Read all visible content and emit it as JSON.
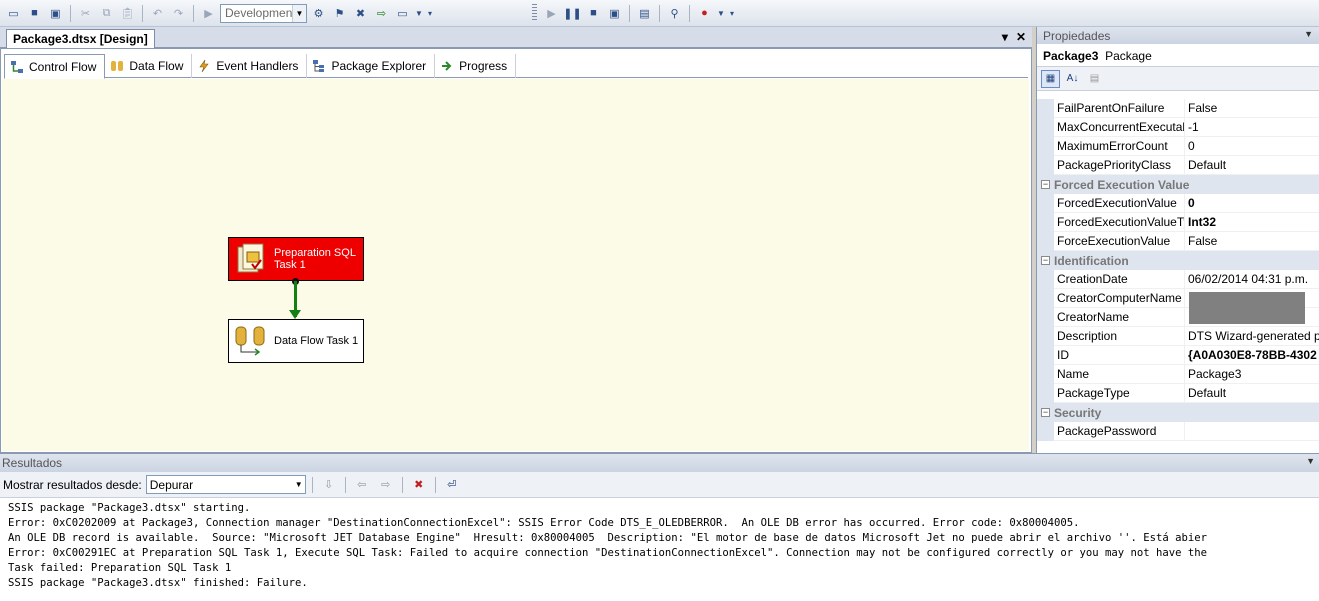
{
  "toolbar": {
    "configuration": "Development",
    "icons": [
      "new-item-icon",
      "save-icon",
      "save-all-icon",
      "cut-icon",
      "copy-icon",
      "paste-icon",
      "undo-icon",
      "redo-icon",
      "navigate-icon",
      "solution-config-combo",
      "connection-icon",
      "package-config-icon",
      "tools-icon",
      "import-icon",
      "window-icon",
      "start-icon",
      "pause-icon",
      "stop-icon",
      "restart-icon",
      "comment-icon",
      "breakpoint-icon",
      "options-icon"
    ]
  },
  "document": {
    "tab_label": "Package3.dtsx [Design]",
    "controls": [
      "▾",
      "✕"
    ]
  },
  "designer_tabs": [
    {
      "label": "Control Flow",
      "active": true
    },
    {
      "label": "Data Flow",
      "active": false
    },
    {
      "label": "Event Handlers",
      "active": false
    },
    {
      "label": "Package Explorer",
      "active": false
    },
    {
      "label": "Progress",
      "active": false
    }
  ],
  "tasks": {
    "prep": {
      "label": "Preparation SQL Task 1",
      "status": "failed",
      "color": "#ee0000"
    },
    "dataflow": {
      "label": "Data Flow Task 1"
    }
  },
  "colors": {
    "connector": "#138013",
    "canvas": "#fcfbe8"
  },
  "properties": {
    "title": "Propiedades",
    "object_name": "Package3",
    "object_type": "Package",
    "rows": [
      {
        "kind": "prop",
        "name": "FailParentOnFailure",
        "value": "False"
      },
      {
        "kind": "prop",
        "name": "MaxConcurrentExecutab",
        "value": "-1"
      },
      {
        "kind": "prop",
        "name": "MaximumErrorCount",
        "value": "0"
      },
      {
        "kind": "prop",
        "name": "PackagePriorityClass",
        "value": "Default"
      },
      {
        "kind": "cat",
        "name": "Forced Execution Value"
      },
      {
        "kind": "prop",
        "name": "ForcedExecutionValue",
        "value": "0",
        "bold": true
      },
      {
        "kind": "prop",
        "name": "ForcedExecutionValueTy",
        "value": "Int32",
        "bold": true
      },
      {
        "kind": "prop",
        "name": "ForceExecutionValue",
        "value": "False"
      },
      {
        "kind": "cat",
        "name": "Identification"
      },
      {
        "kind": "prop",
        "name": "CreationDate",
        "value": "06/02/2014 04:31 p.m."
      },
      {
        "kind": "prop",
        "name": "CreatorComputerName",
        "value": ""
      },
      {
        "kind": "prop",
        "name": "CreatorName",
        "value": ""
      },
      {
        "kind": "prop",
        "name": "Description",
        "value": "DTS Wizard-generated pa"
      },
      {
        "kind": "prop",
        "name": "ID",
        "value": "{A0A030E8-78BB-4302",
        "bold": true
      },
      {
        "kind": "prop",
        "name": "Name",
        "value": "Package3"
      },
      {
        "kind": "prop",
        "name": "PackageType",
        "value": "Default"
      },
      {
        "kind": "cat",
        "name": "Security"
      },
      {
        "kind": "prop",
        "name": "PackagePassword",
        "value": ""
      }
    ]
  },
  "results": {
    "title": "Resultados",
    "show_from_label": "Mostrar resultados desde:",
    "show_from_value": "Depurar",
    "lines": [
      "SSIS package \"Package3.dtsx\" starting.",
      "Error: 0xC0202009 at Package3, Connection manager \"DestinationConnectionExcel\": SSIS Error Code DTS_E_OLEDBERROR.  An OLE DB error has occurred. Error code: 0x80004005.",
      "An OLE DB record is available.  Source: \"Microsoft JET Database Engine\"  Hresult: 0x80004005  Description: \"El motor de base de datos Microsoft Jet no puede abrir el archivo ''. Está abier",
      "Error: 0xC00291EC at Preparation SQL Task 1, Execute SQL Task: Failed to acquire connection \"DestinationConnectionExcel\". Connection may not be configured correctly or you may not have the",
      "Task failed: Preparation SQL Task 1",
      "SSIS package \"Package3.dtsx\" finished: Failure."
    ]
  }
}
